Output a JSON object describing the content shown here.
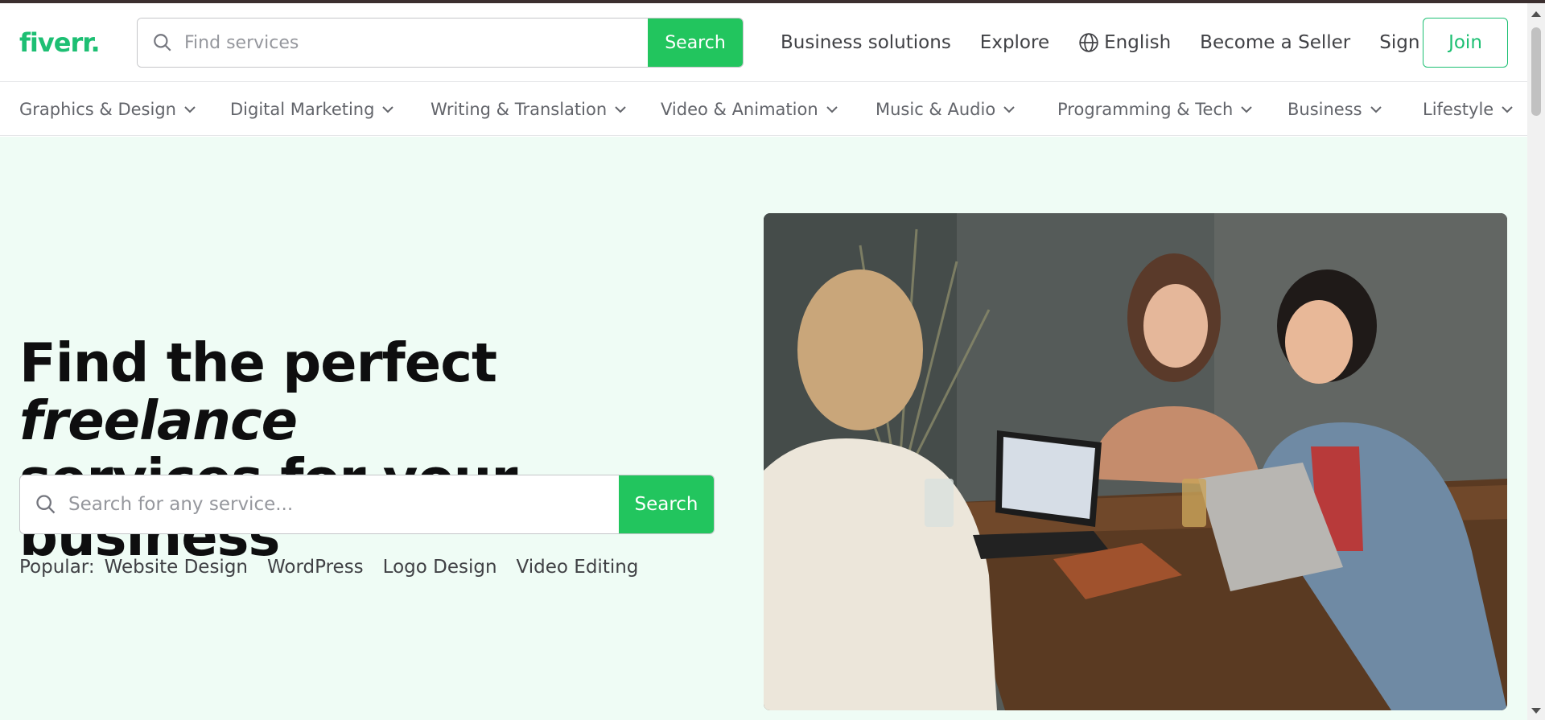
{
  "header": {
    "logo": "fiverr",
    "logo_dot": ".",
    "search": {
      "placeholder": "Find services",
      "button_label": "Search"
    },
    "nav": {
      "business_solutions": "Business solutions",
      "explore": "Explore",
      "language": "English",
      "become_seller": "Become a Seller",
      "sign_in": "Sign in",
      "join": "Join"
    }
  },
  "categories": [
    {
      "label": "Graphics & Design"
    },
    {
      "label": "Digital Marketing"
    },
    {
      "label": "Writing & Translation"
    },
    {
      "label": "Video & Animation"
    },
    {
      "label": "Music & Audio"
    },
    {
      "label": "Programming & Tech"
    },
    {
      "label": "Business"
    },
    {
      "label": "Lifestyle"
    }
  ],
  "hero": {
    "headline_part1": "Find the perfect ",
    "headline_italic": "freelance",
    "headline_part2": "services for your business",
    "search": {
      "placeholder": "Search for any service...",
      "button_label": "Search"
    },
    "popular_label": "Popular:",
    "popular_tags": [
      "Website Design",
      "WordPress",
      "Logo Design",
      "Video Editing"
    ]
  },
  "colors": {
    "brand_green": "#1dbf73",
    "button_green": "#22c55e",
    "hero_bg": "#effcf5"
  }
}
